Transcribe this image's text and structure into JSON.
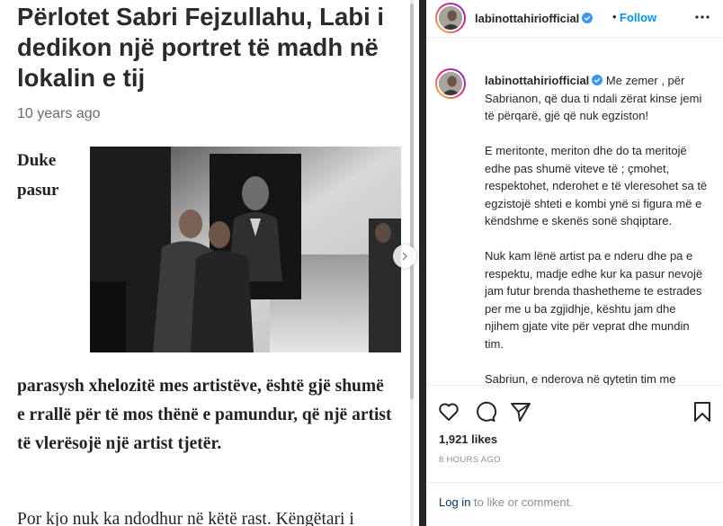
{
  "article": {
    "title": "Përlotet Sabri Fejzullahu, Labi i dedikon një portret të madh në lokalin e tij",
    "date": "10 years ago",
    "lead_word_1": "Duke",
    "lead_word_2": "pasur",
    "body_1": "parasysh xhelozitë mes artistëve, është gjë shumë e rrallë për të mos thënë e pamundur, që një artist të vlerësojë një artist tjetër.",
    "body_2": "Por kjo nuk ka ndodhur në këtë rast. Këngëtari i"
  },
  "post": {
    "username": "labinottahiriofficial",
    "follow_label": "Follow",
    "dot": "•",
    "caption_user": "labinottahiriofficial",
    "caption_p1": "Me zemer , për Sabrianon, që dua ti ndali zërat kinse jemi të përqarë, gjë që nuk egziston!",
    "caption_p2": "E meritonte, meriton dhe do ta meritojë edhe pas shumë viteve të ; çmohet, respektohet, nderohet e të vleresohet sa të egzistojë shteti e kombi ynë si figura më e këndshme e skenës sonë shqiptare.",
    "caption_p3": "Nuk kam lënë artist pa e nderu dhe pa e respektu, madje edhe kur ka pasur nevojë jam futur brenda thashetheme te estrades per me u ba zgjidhje, kështu jam dhe njihem gjate vite për veprat dhe mundin tim.",
    "caption_p4": "Sabriun, e nderova në qytetin tim me",
    "likes": "1,921 likes",
    "time": "8 HOURS AGO",
    "login_link": "Log in",
    "login_rest": " to like or comment."
  },
  "icons": {
    "verified": "verified-badge-icon",
    "more": "more-options-icon",
    "like": "heart-icon",
    "comment": "comment-icon",
    "share": "share-icon",
    "save": "bookmark-icon",
    "next": "chevron-right-icon"
  },
  "colors": {
    "accent": "#0095f6",
    "verified": "#3897f0",
    "link": "#00376b",
    "muted": "#8e8e8e"
  }
}
